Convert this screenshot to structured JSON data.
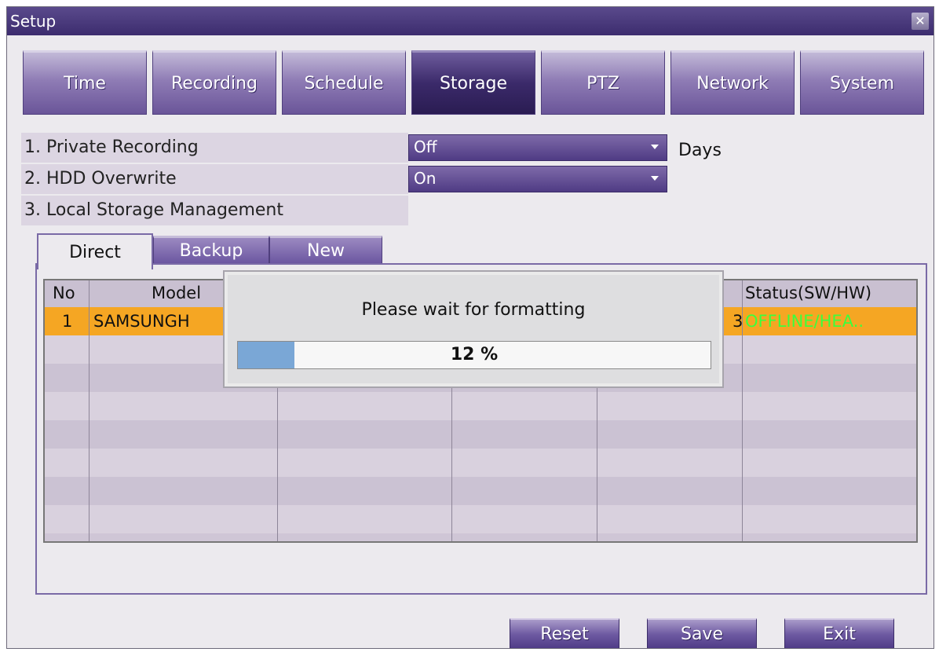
{
  "window": {
    "title": "Setup",
    "close_glyph": "✕"
  },
  "tabs": [
    {
      "label": "Time"
    },
    {
      "label": "Recording"
    },
    {
      "label": "Schedule"
    },
    {
      "label": "Storage",
      "active": true
    },
    {
      "label": "PTZ"
    },
    {
      "label": "Network"
    },
    {
      "label": "System"
    }
  ],
  "settings": {
    "private_recording": {
      "label": "1. Private Recording",
      "value": "Off",
      "suffix": "Days"
    },
    "hdd_overwrite": {
      "label": "2. HDD Overwrite",
      "value": "On"
    },
    "local_storage": {
      "label": "3. Local Storage Management"
    }
  },
  "subtabs": [
    {
      "label": "Direct",
      "active": true
    },
    {
      "label": "Backup"
    },
    {
      "label": "New"
    }
  ],
  "table": {
    "headers": [
      "No",
      "Model",
      "",
      "",
      "",
      "Status(SW/HW)"
    ],
    "rows": [
      {
        "no": "1",
        "model": "SAMSUNGH",
        "hidden_tail": "3",
        "status": "OFFLINE/HEA.."
      }
    ]
  },
  "dialog": {
    "message": "Please wait for formatting",
    "progress_text": "12 %",
    "progress_value": 12
  },
  "buttons": {
    "reset": "Reset",
    "save": "Save",
    "exit": "Exit"
  },
  "colors": {
    "accent": "#4f3b84",
    "highlight_row": "#f5a623",
    "status_text": "#3cff3c",
    "progress_fill": "#7aa7d6"
  }
}
